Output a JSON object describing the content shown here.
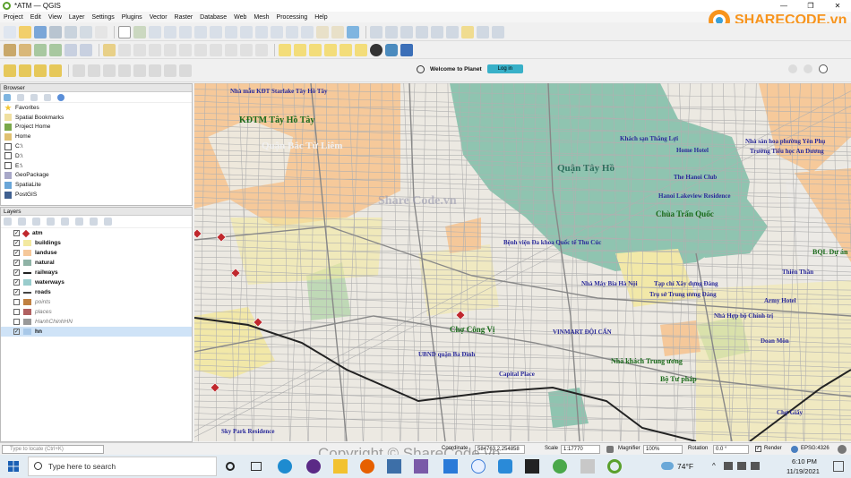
{
  "window": {
    "title": "*ATM — QGIS",
    "controls": [
      "—",
      "❐",
      "✕"
    ]
  },
  "menu": [
    "Project",
    "Edit",
    "View",
    "Layer",
    "Settings",
    "Plugins",
    "Vector",
    "Raster",
    "Database",
    "Web",
    "Mesh",
    "Processing",
    "Help"
  ],
  "watermark_logo": "SHARECODE.vn",
  "planet": {
    "welcome": "Welcome to Planet",
    "login": "Log in"
  },
  "browser": {
    "title": "Browser",
    "items": [
      "Favorites",
      "Spatial Bookmarks",
      "Project Home",
      "Home",
      "C:\\",
      "D:\\",
      "E:\\",
      "GeoPackage",
      "SpatiaLite",
      "PostGIS"
    ]
  },
  "layers": {
    "title": "Layers",
    "items": [
      {
        "name": "atm",
        "checked": true,
        "bold": true,
        "color": "#c0282d"
      },
      {
        "name": "buildings",
        "checked": true,
        "bold": true,
        "color": "#f3e9a0"
      },
      {
        "name": "landuse",
        "checked": true,
        "bold": true,
        "color": "#f5c89a"
      },
      {
        "name": "natural",
        "checked": true,
        "bold": true,
        "color": "#8fb3a6"
      },
      {
        "name": "railways",
        "checked": true,
        "bold": true,
        "color": "#222222"
      },
      {
        "name": "waterways",
        "checked": true,
        "bold": true,
        "color": "#9cc"
      },
      {
        "name": "roads",
        "checked": true,
        "bold": true,
        "color": "#444444"
      },
      {
        "name": "points",
        "checked": false,
        "bold": false,
        "color": "#c08040"
      },
      {
        "name": "places",
        "checked": false,
        "bold": false,
        "color": "#b06060"
      },
      {
        "name": "HanhChinhHN",
        "checked": false,
        "bold": false,
        "color": "#999999"
      },
      {
        "name": "hn",
        "checked": true,
        "bold": true,
        "color": "#a8c8e8"
      }
    ]
  },
  "map_labels": [
    {
      "text": "Nhà mẫu KĐT Starlake Tây Hồ Tây",
      "color": "#2a2a9a",
      "size": 7
    },
    {
      "text": "KĐTM Tây Hồ Tây",
      "color": "#1a6a1a",
      "size": 10
    },
    {
      "text": "Quận Bắc Từ Liêm",
      "color": "#f0f0f0",
      "size": 11
    },
    {
      "text": "Quận Tây Hồ",
      "color": "#2e6f5e",
      "size": 11
    },
    {
      "text": "Khách sạn Thắng Lợi",
      "color": "#2a2a9a",
      "size": 7
    },
    {
      "text": "Nhà sản hoa phường Yên Phụ",
      "color": "#2a2a9a",
      "size": 7
    },
    {
      "text": "Trường Tiểu học An Dương",
      "color": "#2a2a9a",
      "size": 7
    },
    {
      "text": "Home Hotel",
      "color": "#2a2a9a",
      "size": 7
    },
    {
      "text": "The Hanoi Club",
      "color": "#2a2a9a",
      "size": 7
    },
    {
      "text": "Hanoi Lakeview Residence",
      "color": "#2a2a9a",
      "size": 7
    },
    {
      "text": "Chùa Trấn Quốc",
      "color": "#1a6a1a",
      "size": 9
    },
    {
      "text": "Bệnh viện Đa khoa Quốc tế Thu Cúc",
      "color": "#2a2a9a",
      "size": 7
    },
    {
      "text": "Nhà Máy Bia Hà Nội",
      "color": "#2a2a9a",
      "size": 7
    },
    {
      "text": "Trụ sở Trung ương Đảng",
      "color": "#2a2a9a",
      "size": 7
    },
    {
      "text": "Tạp chí Xây dựng Đảng",
      "color": "#2a2a9a",
      "size": 7
    },
    {
      "text": "Chợ Công Vị",
      "color": "#1a6a1a",
      "size": 9
    },
    {
      "text": "VINMART ĐỘI CẤN",
      "color": "#2a2a9a",
      "size": 7
    },
    {
      "text": "Nhà khách Trung ương",
      "color": "#1a6a1a",
      "size": 8
    },
    {
      "text": "Bộ Tư pháp",
      "color": "#1a6a1a",
      "size": 8
    },
    {
      "text": "UBND quận Ba Đình",
      "color": "#2a2a9a",
      "size": 7
    },
    {
      "text": "Capital Place",
      "color": "#2a2a9a",
      "size": 7
    },
    {
      "text": "Sky Park Residence",
      "color": "#2a2a9a",
      "size": 7
    },
    {
      "text": "Doan Môn",
      "color": "#2a2a9a",
      "size": 7
    },
    {
      "text": "Army Hotel",
      "color": "#2a2a9a",
      "size": 7
    },
    {
      "text": "Thiên Thần",
      "color": "#2a2a9a",
      "size": 7
    },
    {
      "text": "BQL Dự án",
      "color": "#1a6a1a",
      "size": 8
    },
    {
      "text": "Nhà Hợp bộ Chính trị",
      "color": "#2a2a9a",
      "size": 7
    },
    {
      "text": "Chợ Giấy",
      "color": "#2a2a9a",
      "size": 7
    },
    {
      "text": "Share Code.vn",
      "color": "#9a9ab0",
      "size": 14
    }
  ],
  "statusbar": {
    "search_placeholder": "Type to locate (Ctrl+K)",
    "coordinate_label": "Coordinate",
    "coordinate_value": "584763.2,254858",
    "scale_label": "Scale",
    "scale_value": "1:17770",
    "magnifier_label": "Magnifier",
    "magnifier_value": "100%",
    "rotation_label": "Rotation",
    "rotation_value": "0.0 °",
    "render_label": "Render",
    "crs": "EPSG:4326"
  },
  "footer_watermark": "Copyright © ShareCode.vn",
  "taskbar": {
    "search_placeholder": "Type here to search",
    "weather": "74°F",
    "time": "6:10 PM",
    "date": "11/19/2021"
  }
}
